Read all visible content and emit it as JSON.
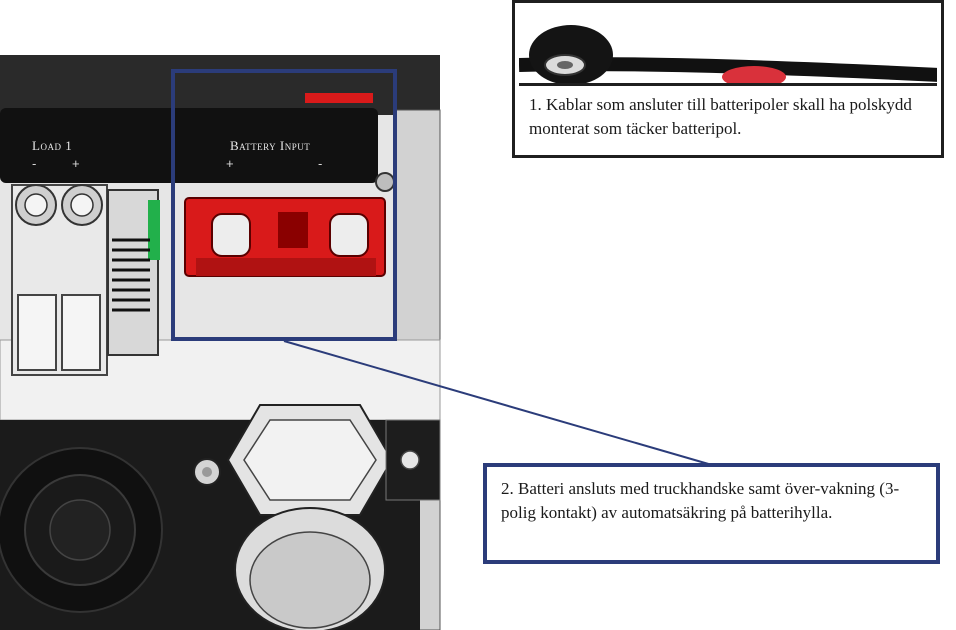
{
  "panel": {
    "load_label": "Load 1",
    "load_minus": "-",
    "load_plus": "+",
    "battery_label": "Battery Input",
    "battery_plus": "+",
    "battery_minus": "-"
  },
  "callouts": {
    "one_text": "1. Kablar som ansluter till batteripoler skall ha polskydd monterat som täcker batteripol.",
    "two_text": "2. Batteri ansluts med truckhandske samt över-vakning (3-polig kontakt) av automatsäkring på batterihylla."
  },
  "colors": {
    "callout_border": "#2b3c7a",
    "connector_red": "#d91a1a",
    "panel_black": "#111111"
  }
}
